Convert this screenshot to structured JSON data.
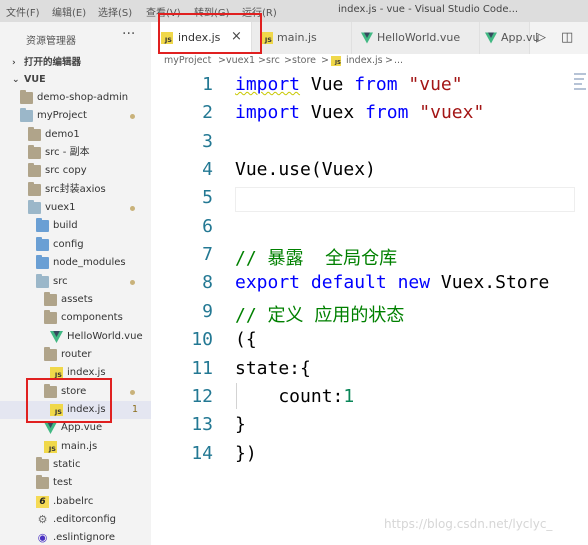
{
  "titlebar": {
    "menu": [
      "文件(F)",
      "编辑(E)",
      "选择(S)",
      "查看(V)",
      "转到(G)",
      "运行(R)"
    ],
    "window_title": "index.js - vue - Visual Studio Code..."
  },
  "sidebar": {
    "title": "资源管理器",
    "more": "···",
    "sections": {
      "open_editors": "打开的编辑器",
      "workspace": "VUE"
    },
    "items": [
      {
        "label": "demo-shop-admin",
        "icon": "folder-icon"
      },
      {
        "label": "myProject",
        "icon": "folder-open-icon",
        "dot": true
      },
      {
        "label": "demo1",
        "icon": "folder-icon"
      },
      {
        "label": "src - 副本",
        "icon": "folder-icon"
      },
      {
        "label": "src copy",
        "icon": "folder-icon"
      },
      {
        "label": "src封装axios",
        "icon": "folder-icon"
      },
      {
        "label": "vuex1",
        "icon": "folder-open-icon",
        "dot": true
      },
      {
        "label": "build",
        "icon": "folder-blue-icon"
      },
      {
        "label": "config",
        "icon": "folder-blue-icon"
      },
      {
        "label": "node_modules",
        "icon": "folder-blue-icon"
      },
      {
        "label": "src",
        "icon": "folder-open-icon",
        "dot": true
      },
      {
        "label": "assets",
        "icon": "folder-icon"
      },
      {
        "label": "components",
        "icon": "folder-icon"
      },
      {
        "label": "HelloWorld.vue",
        "icon": "vue-icon"
      },
      {
        "label": "router",
        "icon": "folder-icon"
      },
      {
        "label": "index.js",
        "icon": "js-icon"
      },
      {
        "label": "store",
        "icon": "folder-icon",
        "dot": true
      },
      {
        "label": "index.js",
        "icon": "js-icon",
        "badge": "1"
      },
      {
        "label": "App.vue",
        "icon": "vue-icon"
      },
      {
        "label": "main.js",
        "icon": "js-icon"
      },
      {
        "label": "static",
        "icon": "folder-icon"
      },
      {
        "label": "test",
        "icon": "folder-icon"
      },
      {
        "label": ".babelrc",
        "icon": "babel-icon"
      },
      {
        "label": ".editorconfig",
        "icon": "gear-icon"
      },
      {
        "label": ".eslintignore",
        "icon": "eslint-icon"
      }
    ]
  },
  "tabs": [
    {
      "label": "index.js",
      "close": "×",
      "active": true
    },
    {
      "label": "main.js",
      "active": false
    },
    {
      "label": "HelloWorld.vue",
      "active": false
    },
    {
      "label": "App.vu",
      "active": false
    }
  ],
  "toolbar": {
    "run": "▷",
    "split": "◫"
  },
  "breadcrumb": [
    "myProject",
    ">",
    "vuex1",
    ">",
    "src",
    ">",
    "store",
    ">",
    "index.js",
    ">",
    "..."
  ],
  "editor": {
    "line_numbers": [
      "1",
      "2",
      "3",
      "4",
      "5",
      "6",
      "7",
      "8",
      "9",
      "10",
      "11",
      "12",
      "13",
      "14"
    ],
    "lines": [
      [
        {
          "t": "import",
          "c": "kw",
          "sq": true
        },
        {
          "t": " Vue "
        },
        {
          "t": "from",
          "c": "kw"
        },
        {
          "t": " "
        },
        {
          "t": "\"vue\"",
          "c": "str"
        }
      ],
      [
        {
          "t": "import",
          "c": "kw"
        },
        {
          "t": " Vuex "
        },
        {
          "t": "from",
          "c": "kw"
        },
        {
          "t": " "
        },
        {
          "t": "\"vuex\"",
          "c": "str"
        }
      ],
      [],
      [
        {
          "t": "Vue.use(Vuex)"
        }
      ],
      [],
      [],
      [
        {
          "t": "// 暴露  全局仓库",
          "c": "cmt"
        }
      ],
      [
        {
          "t": "export",
          "c": "kw"
        },
        {
          "t": " "
        },
        {
          "t": "default",
          "c": "kw"
        },
        {
          "t": " "
        },
        {
          "t": "new",
          "c": "kw"
        },
        {
          "t": " Vuex.Store"
        }
      ],
      [
        {
          "t": "// 定义 应用的状态",
          "c": "cmt"
        }
      ],
      [
        {
          "t": "({"
        }
      ],
      [
        {
          "t": "state:{"
        }
      ],
      [
        {
          "t": "    count:"
        },
        {
          "t": "1",
          "c": "num"
        }
      ],
      [
        {
          "t": "}"
        }
      ],
      [
        {
          "t": "})"
        }
      ]
    ]
  },
  "watermark": "https://blog.csdn.net/lyclyc_",
  "colors": {
    "keyword": "#0000ff",
    "string": "#a31515",
    "comment": "#008000",
    "number": "#098658",
    "line_number": "#237893",
    "highlight_box": "#e02020"
  }
}
